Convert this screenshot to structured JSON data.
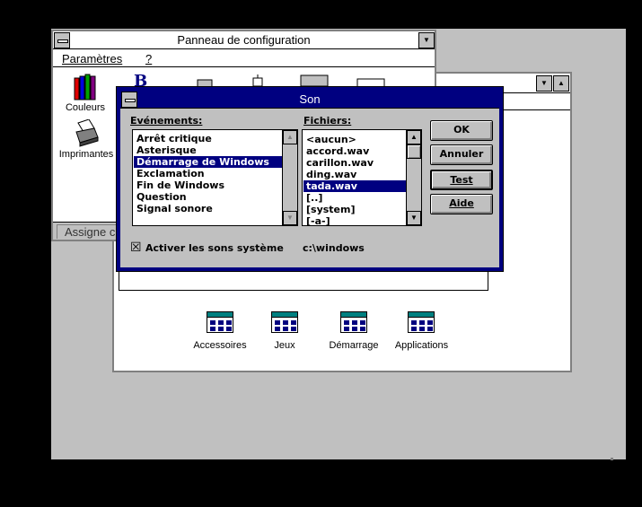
{
  "control_panel": {
    "title": "Panneau de configuration",
    "menu": {
      "parametres": "Paramètres",
      "help": "?"
    },
    "icons": {
      "couleurs": "Couleurs",
      "imprimantes": "Imprimantes"
    },
    "status": "Assigne c"
  },
  "program_manager": {
    "groups": [
      {
        "label": "Accessoires"
      },
      {
        "label": "Jeux"
      },
      {
        "label": "Démarrage"
      },
      {
        "label": "Applications"
      }
    ]
  },
  "sound_dialog": {
    "title": "Son",
    "events_label": "Evénements:",
    "events": [
      "Arrêt critique",
      "Asterisque",
      "Démarrage de Windows",
      "Exclamation",
      "Fin de Windows",
      "Question",
      "Signal sonore"
    ],
    "events_selected_index": 2,
    "files_label": "Fichiers:",
    "files": [
      "<aucun>",
      "accord.wav",
      "carillon.wav",
      "ding.wav",
      "tada.wav",
      "[..]",
      "[system]",
      "[-a-]"
    ],
    "files_selected_index": 4,
    "buttons": {
      "ok": "OK",
      "annuler": "Annuler",
      "test": "Test",
      "aide": "Aide"
    },
    "enable_checkbox": {
      "label": "Activer les sons système",
      "checked": true,
      "mark": "☒"
    },
    "path": "c:\\windows"
  },
  "colors": {
    "selection": "#000080",
    "dialog_border": "#000080",
    "face": "#c0c0c0"
  }
}
